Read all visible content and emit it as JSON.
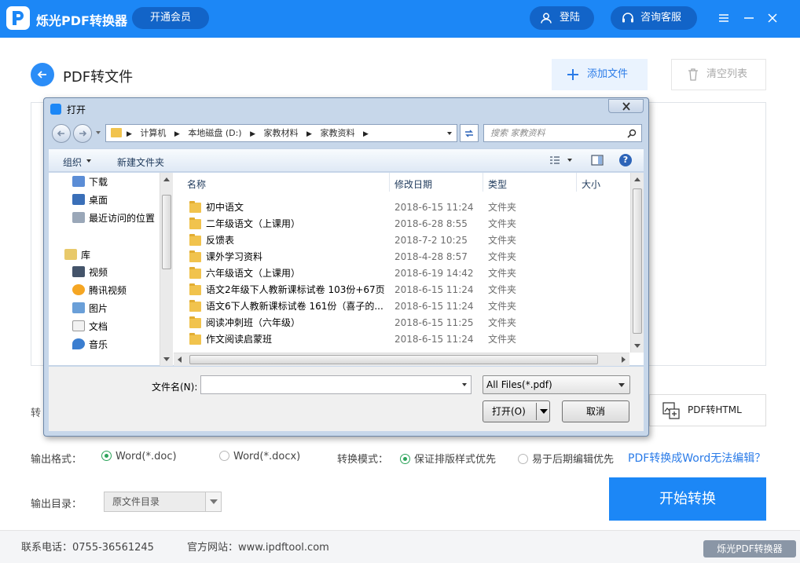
{
  "app": {
    "title": "烁光PDF转换器",
    "vip_label": "开通会员",
    "login_label": "登陆",
    "service_label": "咨询客服",
    "accent": "#1c87f6"
  },
  "header": {
    "page_title": "PDF转文件",
    "add_file_label": "添加文件",
    "clear_list_label": "清空列表"
  },
  "convert": {
    "label_partial": "转",
    "html_button": "PDF转HTML"
  },
  "options": {
    "format_label": "输出格式：",
    "format_doc": "Word(*.doc)",
    "format_docx": "Word(*.docx)",
    "format_selected": "Word(*.doc)",
    "mode_label": "转换模式：",
    "mode_layout": "保证排版样式优先",
    "mode_edit": "易于后期编辑优先",
    "mode_selected": "保证排版样式优先",
    "help_link": "PDF转换成Word无法编辑？",
    "dir_label": "输出目录：",
    "dir_value": "原文件目录",
    "start_button": "开始转换"
  },
  "footer": {
    "phone": "联系电话：0755-36561245",
    "site": "官方网站：www.ipdftool.com",
    "watermark": "烁光PDF转换器"
  },
  "dialog": {
    "title": "打开",
    "breadcrumbs": [
      "计算机",
      "本地磁盘 (D:)",
      "家教材料",
      "家教资料"
    ],
    "search_placeholder": "搜索 家教资料",
    "organize": "组织",
    "new_folder": "新建文件夹",
    "nav_items": [
      {
        "label": "下载",
        "icon": "download-folder-icon"
      },
      {
        "label": "桌面",
        "icon": "desktop-icon"
      },
      {
        "label": "最近访问的位置",
        "icon": "recent-places-icon"
      },
      {
        "label": "库",
        "icon": "library-icon"
      },
      {
        "label": "视频",
        "icon": "video-icon"
      },
      {
        "label": "腾讯视频",
        "icon": "tencent-video-icon"
      },
      {
        "label": "图片",
        "icon": "pictures-icon"
      },
      {
        "label": "文档",
        "icon": "documents-icon"
      },
      {
        "label": "音乐",
        "icon": "music-icon"
      }
    ],
    "columns": {
      "name": "名称",
      "date": "修改日期",
      "type": "类型",
      "size": "大小"
    },
    "files": [
      {
        "name": "初中语文",
        "date": "2018-6-15 11:24",
        "type": "文件夹"
      },
      {
        "name": "二年级语文（上课用）",
        "date": "2018-6-28 8:55",
        "type": "文件夹"
      },
      {
        "name": "反馈表",
        "date": "2018-7-2 10:25",
        "type": "文件夹"
      },
      {
        "name": "课外学习资料",
        "date": "2018-4-28 8:57",
        "type": "文件夹"
      },
      {
        "name": "六年级语文（上课用）",
        "date": "2018-6-19 14:42",
        "type": "文件夹"
      },
      {
        "name": "语文2年级下人教新课标试卷 103份+67页",
        "date": "2018-6-15 11:24",
        "type": "文件夹"
      },
      {
        "name": "语文6下人教新课标试卷 161份（喜子的...",
        "date": "2018-6-15 11:24",
        "type": "文件夹"
      },
      {
        "name": "阅读冲刺班（六年级）",
        "date": "2018-6-15 11:25",
        "type": "文件夹"
      },
      {
        "name": "作文阅读启蒙班",
        "date": "2018-6-15 11:24",
        "type": "文件夹"
      }
    ],
    "filename_label": "文件名(N):",
    "filename_value": "",
    "filetype_value": "All Files(*.pdf)",
    "open_button": "打开(O)",
    "cancel_button": "取消"
  }
}
